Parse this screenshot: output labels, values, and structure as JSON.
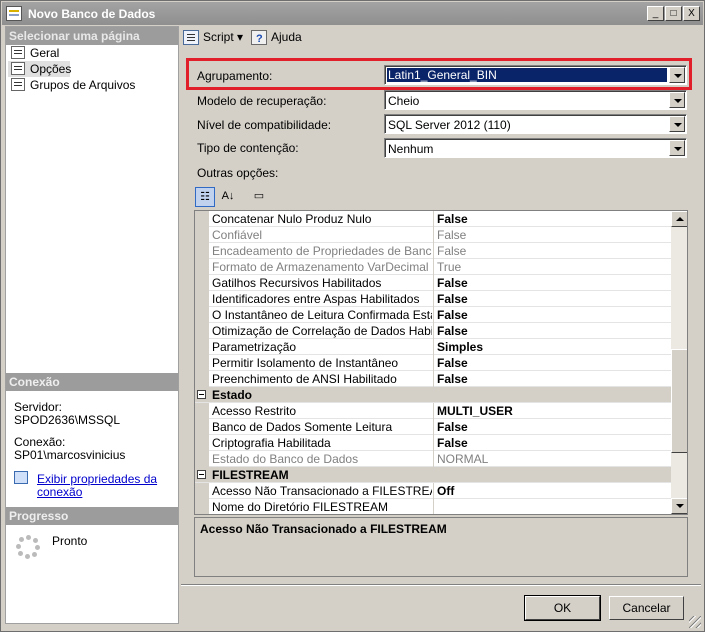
{
  "window": {
    "title": "Novo Banco de Dados",
    "min_label": "_",
    "max_label": "□",
    "close_label": "X"
  },
  "left": {
    "select_header": "Selecionar uma página",
    "pages": [
      {
        "label": "Geral",
        "selected": false
      },
      {
        "label": "Opções",
        "selected": true
      },
      {
        "label": "Grupos de Arquivos",
        "selected": false
      }
    ],
    "connection_header": "Conexão",
    "server_label": "Servidor:",
    "server_value": "SPOD2636\\MSSQL",
    "connection_label": "Conexão:",
    "connection_value": "SP01\\marcosvinicius",
    "view_props_link_1": "Exibir propriedades da",
    "view_props_link_2": "conexão",
    "progress_header": "Progresso",
    "progress_status": "Pronto"
  },
  "toolbar": {
    "script_label": "Script",
    "help_label": "Ajuda"
  },
  "form": {
    "collation": {
      "label": "Agrupamento:",
      "value": "Latin1_General_BIN"
    },
    "recovery": {
      "label": "Modelo de recuperação:",
      "value": "Cheio"
    },
    "compat": {
      "label": "Nível de compatibilidade:",
      "value": "SQL Server 2012 (110)"
    },
    "containment": {
      "label": "Tipo de contenção:",
      "value": "Nenhum"
    },
    "other_options_label": "Outras opções:"
  },
  "grid": {
    "rows": [
      {
        "name": "Concatenar Nulo Produz Nulo",
        "value": "False",
        "bold": true,
        "disabled": false
      },
      {
        "name": "Confiável",
        "value": "False",
        "bold": false,
        "disabled": true
      },
      {
        "name": "Encadeamento de Propriedades de Bancos de",
        "value": "False",
        "bold": false,
        "disabled": true
      },
      {
        "name": "Formato de Armazenamento VarDecimal Habilit",
        "value": "True",
        "bold": false,
        "disabled": true
      },
      {
        "name": "Gatilhos Recursivos Habilitados",
        "value": "False",
        "bold": true,
        "disabled": false
      },
      {
        "name": "Identificadores entre Aspas Habilitados",
        "value": "False",
        "bold": true,
        "disabled": false
      },
      {
        "name": "O Instantâneo de Leitura Confirmada Está Ativo",
        "value": "False",
        "bold": true,
        "disabled": false
      },
      {
        "name": "Otimização de Correlação de Dados Habilitada",
        "value": "False",
        "bold": true,
        "disabled": false
      },
      {
        "name": "Parametrização",
        "value": "Simples",
        "bold": true,
        "disabled": false
      },
      {
        "name": "Permitir Isolamento de Instantâneo",
        "value": "False",
        "bold": true,
        "disabled": false
      },
      {
        "name": "Preenchimento de ANSI Habilitado",
        "value": "False",
        "bold": true,
        "disabled": false
      },
      {
        "category": true,
        "name": "Estado",
        "toggle": "−"
      },
      {
        "name": "Acesso Restrito",
        "value": "MULTI_USER",
        "bold": true,
        "disabled": false
      },
      {
        "name": "Banco de Dados Somente Leitura",
        "value": "False",
        "bold": true,
        "disabled": false
      },
      {
        "name": "Criptografia Habilitada",
        "value": "False",
        "bold": true,
        "disabled": false
      },
      {
        "name": "Estado do Banco de Dados",
        "value": "NORMAL",
        "bold": false,
        "disabled": true
      },
      {
        "category": true,
        "name": "FILESTREAM",
        "toggle": "−"
      },
      {
        "name": "Acesso Não Transacionado a FILESTREAM",
        "value": "Off",
        "bold": true,
        "disabled": false
      },
      {
        "name": "Nome do Diretório FILESTREAM",
        "value": "",
        "bold": false,
        "disabled": false
      }
    ],
    "description": "Acesso Não Transacionado a FILESTREAM"
  },
  "buttons": {
    "ok": "OK",
    "cancel": "Cancelar"
  },
  "colors": {
    "highlight_box": "#e01f2a",
    "selection": "#0a246a"
  }
}
